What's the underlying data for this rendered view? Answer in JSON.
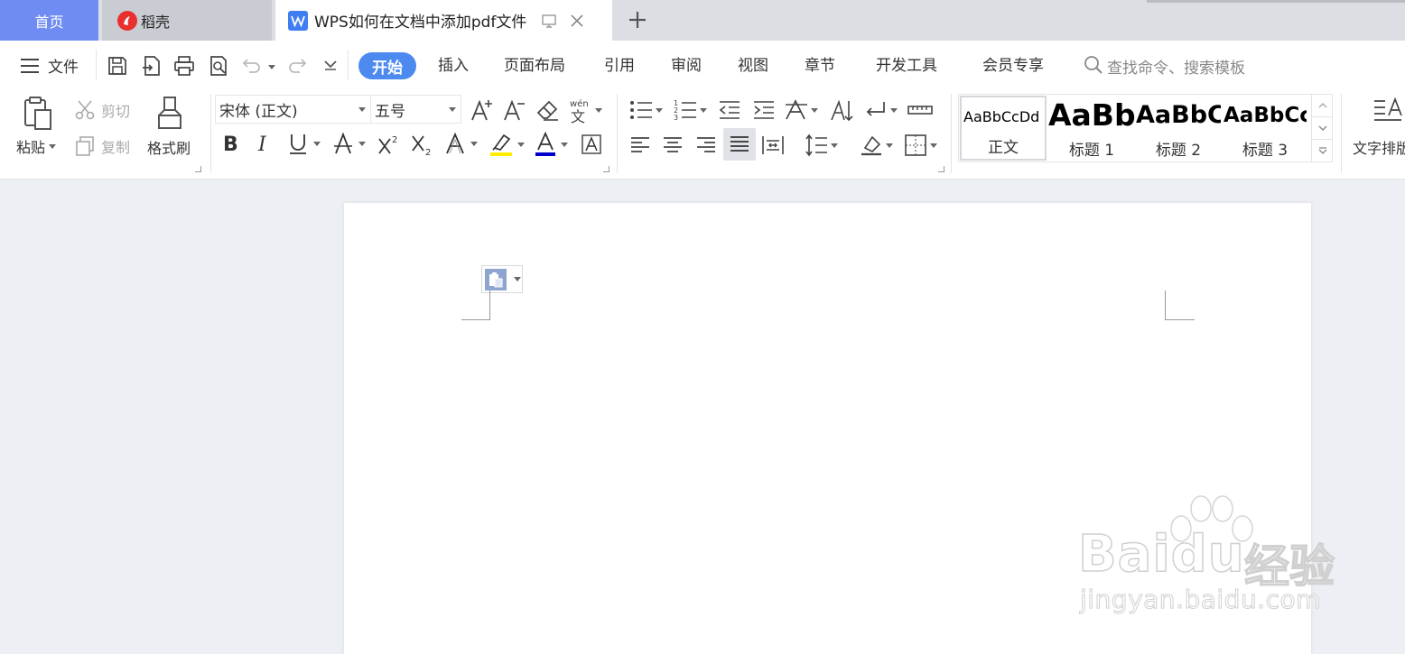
{
  "tabs": {
    "home": "首页",
    "daoke": "稻壳",
    "document": "WPS如何在文档中添加pdf文件"
  },
  "menu": {
    "file": "文件",
    "start": "开始",
    "items": [
      "插入",
      "页面布局",
      "引用",
      "审阅",
      "视图",
      "章节",
      "开发工具",
      "会员专享"
    ],
    "search_placeholder": "查找命令、搜索模板"
  },
  "ribbon": {
    "paste": "粘贴",
    "cut": "剪切",
    "copy": "复制",
    "format_painter": "格式刷",
    "font_name": "宋体 (正文)",
    "font_size": "五号",
    "text_layout": "文字排版"
  },
  "styles": [
    {
      "sample": "AaBbCcDd",
      "name": "正文"
    },
    {
      "sample": "AaBb",
      "name": "标题 1"
    },
    {
      "sample": "AaBbC",
      "name": "标题 2"
    },
    {
      "sample": "AaBbCc",
      "name": "标题 3"
    }
  ],
  "watermark": {
    "brand": "Bai",
    "brand2": "du",
    "cn": "经验",
    "url": "jingyan.baidu.com"
  },
  "colors": {
    "accent": "#4d8af0",
    "home_tab": "#6f8cf2",
    "highlight": "#ffee00",
    "font_color": "#0000cc"
  }
}
